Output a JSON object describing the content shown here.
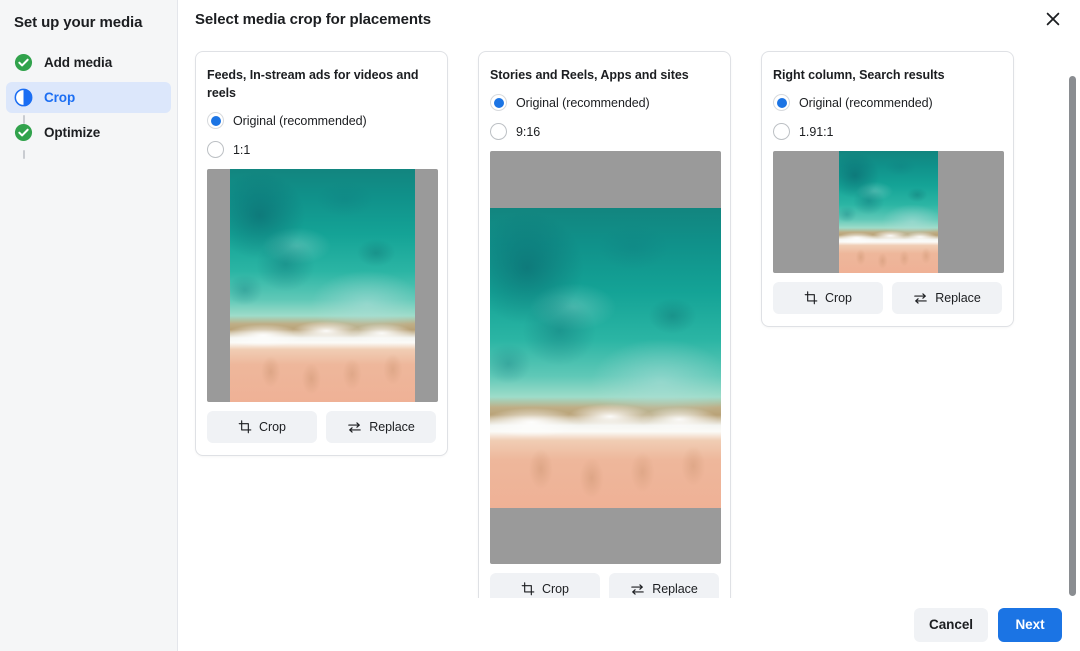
{
  "sidebar": {
    "title": "Set up your media",
    "items": [
      {
        "label": "Add media",
        "icon": "check-circle-icon",
        "state": "complete"
      },
      {
        "label": "Crop",
        "icon": "half-circle-icon",
        "state": "active"
      },
      {
        "label": "Optimize",
        "icon": "check-circle-icon",
        "state": "complete"
      }
    ]
  },
  "header": {
    "title": "Select media crop for placements",
    "close_icon": "close-icon"
  },
  "cards": [
    {
      "title": "Feeds, In-stream ads for videos and reels",
      "options": [
        {
          "label": "Original (recommended)",
          "selected": true
        },
        {
          "label": "1:1",
          "selected": false
        }
      ],
      "crop_label": "Crop",
      "replace_label": "Replace",
      "preview": {
        "aspect": "1:1",
        "letterbox": "vertical-bars"
      }
    },
    {
      "title": "Stories and Reels, Apps and sites",
      "options": [
        {
          "label": "Original (recommended)",
          "selected": true
        },
        {
          "label": "9:16",
          "selected": false
        }
      ],
      "crop_label": "Crop",
      "replace_label": "Replace",
      "preview": {
        "aspect": "9:16",
        "letterbox": "horizontal-bars"
      }
    },
    {
      "title": "Right column, Search results",
      "options": [
        {
          "label": "Original (recommended)",
          "selected": true
        },
        {
          "label": "1.91:1",
          "selected": false
        }
      ],
      "crop_label": "Crop",
      "replace_label": "Replace",
      "preview": {
        "aspect": "1.91:1",
        "letterbox": "vertical-bars"
      }
    }
  ],
  "footer": {
    "cancel_label": "Cancel",
    "next_label": "Next"
  },
  "colors": {
    "accent": "#1b74e4",
    "active_step_bg": "#dce7fb",
    "active_step_text": "#1b6ef3",
    "complete_check": "#31a24c",
    "letterbox_gray": "#9a9a9a",
    "button_gray": "#f0f2f5",
    "sidebar_bg": "#f5f6f7"
  }
}
